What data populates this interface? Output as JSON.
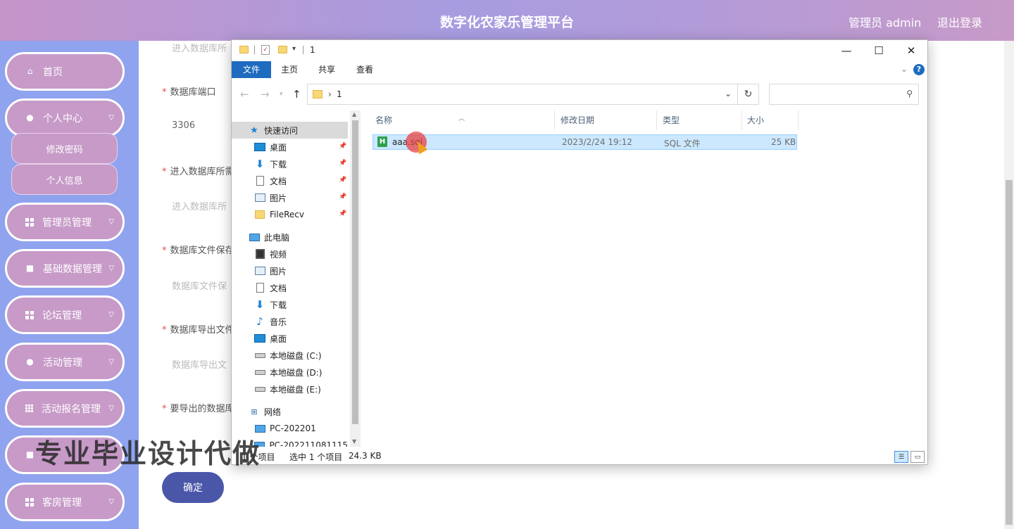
{
  "header": {
    "title": "数字化农家乐管理平台",
    "user": "管理员 admin",
    "logout": "退出登录"
  },
  "sidebar": {
    "items": [
      {
        "label": "首页",
        "icon": "home-icon"
      },
      {
        "label": "个人中心",
        "icon": "user-icon"
      },
      {
        "label": "管理员管理",
        "icon": "grid-icon"
      },
      {
        "label": "基础数据管理",
        "icon": "briefcase-icon"
      },
      {
        "label": "论坛管理",
        "icon": "grid-icon"
      },
      {
        "label": "活动管理",
        "icon": "user-icon"
      },
      {
        "label": "活动报名管理",
        "icon": "grid9-icon"
      },
      {
        "label": "客房管理",
        "icon": "grid-icon"
      }
    ],
    "subitems": [
      "修改密码",
      "个人信息"
    ]
  },
  "form": {
    "top_placeholder": "进入数据库所",
    "fields": [
      {
        "label": "数据库端口",
        "value": "3306"
      },
      {
        "label": "进入数据库所需",
        "placeholder": "进入数据库所"
      },
      {
        "label": "数据库文件保存",
        "placeholder": "数据库文件保"
      },
      {
        "label": "数据库导出文件",
        "placeholder": "数据库导出文"
      },
      {
        "label": "要导出的数据库",
        "placeholder": ""
      }
    ],
    "confirm": "确定"
  },
  "watermark": "专业毕业设计代做",
  "dialog": {
    "title": "1",
    "window_controls": {
      "minimize": "—",
      "maximize": "☐",
      "close": "✕"
    },
    "ribbon_tabs": [
      "文件",
      "主页",
      "共享",
      "查看"
    ],
    "address": {
      "separator": "›",
      "path": "1"
    },
    "search_placeholder": "",
    "nav_items": [
      {
        "label": "快速访问",
        "icon": "star-icon",
        "pinned": false,
        "selected": true
      },
      {
        "label": "桌面",
        "icon": "desktop-icon",
        "pinned": true
      },
      {
        "label": "下载",
        "icon": "download-icon",
        "pinned": true
      },
      {
        "label": "文档",
        "icon": "document-icon",
        "pinned": true
      },
      {
        "label": "图片",
        "icon": "picture-icon",
        "pinned": true
      },
      {
        "label": "FileRecv",
        "icon": "folder-icon",
        "pinned": true
      },
      {
        "label": "此电脑",
        "icon": "computer-icon",
        "pinned": false
      },
      {
        "label": "视频",
        "icon": "video-icon",
        "pinned": false
      },
      {
        "label": "图片",
        "icon": "picture-icon",
        "pinned": false
      },
      {
        "label": "文档",
        "icon": "document-icon",
        "pinned": false
      },
      {
        "label": "下载",
        "icon": "download-icon",
        "pinned": false
      },
      {
        "label": "音乐",
        "icon": "music-icon",
        "pinned": false
      },
      {
        "label": "桌面",
        "icon": "desktop-icon",
        "pinned": false
      },
      {
        "label": "本地磁盘 (C:)",
        "icon": "drive-icon",
        "pinned": false
      },
      {
        "label": "本地磁盘 (D:)",
        "icon": "drive-icon",
        "pinned": false
      },
      {
        "label": "本地磁盘 (E:)",
        "icon": "drive-icon",
        "pinned": false
      },
      {
        "label": "网络",
        "icon": "network-icon",
        "pinned": false
      },
      {
        "label": "PC-202201",
        "icon": "computer-icon",
        "pinned": false
      },
      {
        "label": "PC-202211081115",
        "icon": "computer-icon",
        "pinned": false
      }
    ],
    "columns": [
      "名称",
      "修改日期",
      "类型",
      "大小"
    ],
    "files": [
      {
        "name": "aaa.sql",
        "modified": "2023/2/24 19:12",
        "type": "SQL 文件",
        "size": "25 KB",
        "selected": true
      }
    ],
    "status": {
      "count": "1 个项目",
      "selected": "选中 1 个项目",
      "size": "24.3 KB"
    }
  },
  "colors": {
    "sidebar_bg": "#8fa3ef",
    "menu_item_bg": "#c79ac8",
    "confirm_bg": "#4a57a8",
    "ribbon_active": "#1f6bbf",
    "selection": "#cce8ff"
  }
}
